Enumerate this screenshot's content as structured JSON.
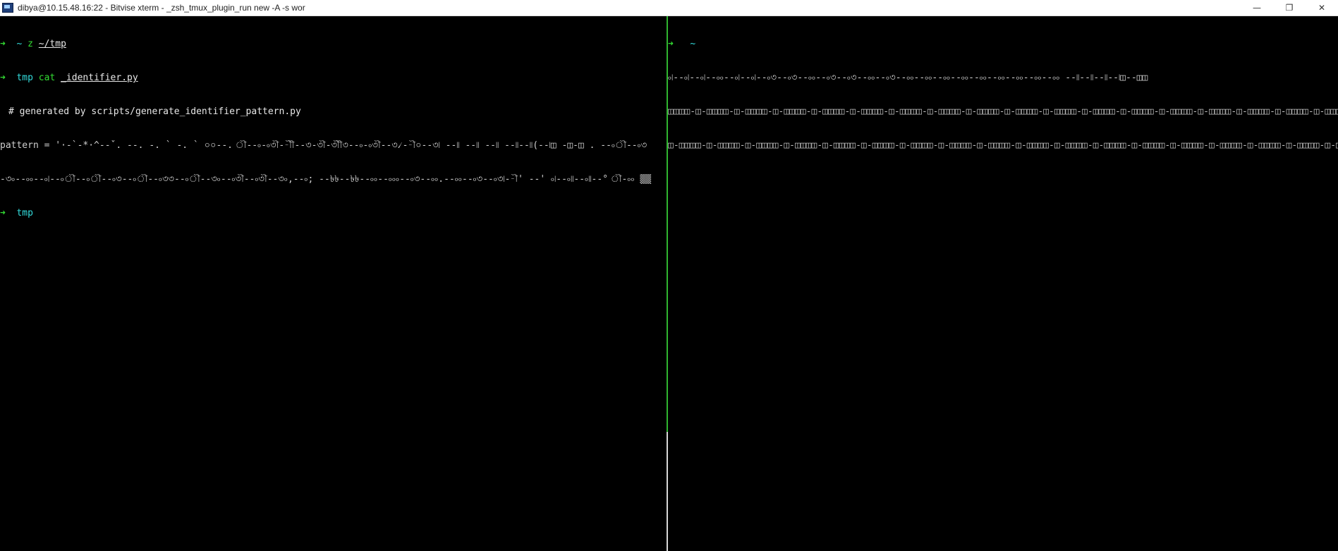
{
  "window": {
    "title": "dibya@10.15.48.16:22 - Bitvise xterm - _zsh_tmux_plugin_run new -A -s wor",
    "controls": [
      "—",
      "❐",
      "✕"
    ]
  },
  "left_pane": {
    "line1": {
      "arrow": "➜",
      "dir": "~",
      "cmd": "z",
      "arg": "~/tmp"
    },
    "line2": {
      "arrow": "➜",
      "dir": "tmp",
      "cmd": "cat",
      "arg": "_identifier.py"
    },
    "line3": "# generated by scripts/generate_identifier_pattern.py",
    "line4": "pattern = '·-`-*·^--ˇ. --. -. ` -. ` ০০--. ৗ--৹-৹৩ৗ--ৗৗ--৩-৩ৗ-৩ৗৗ৩--৹-৹৩ৗ--৩৴--ৗ০--৩৷ --৷৷ --৷৷ --৷৷ --৷৷--৷৷(--৷◫ -◫-◫ . --৹ৗ--৹৩",
    "line5": "-৩৹--৹৹--৹৷--৹ৗ--৹ৗ--৹৩--৹ৗ--৹৩৩--৹ৗ--৩৹--৹৩ৗ--৹৩ৗ--৩৹,--৹; --৳৳--৳৳--৹৹--৹৹৹--৹৩--৹৹.--৹৹--৹৩--৹৩৷--ৗ' --' ৹৷--৹৷৷--৹৷৷--° ৗ-৹৹ ▒▒",
    "line6": {
      "arrow": "➜",
      "dir": "tmp"
    }
  },
  "right_pane": {
    "line1": {
      "arrow": "➜",
      "dir": "~"
    },
    "line2": "৹৷--৹৷--৹৷--৹৹--৹৷--৹৷--৹৩--৹৩--৹৹--৹৩--৹৩--৹৹--৹৩--৹৹--৹৹--৹৹--৹৹--৹৹--৹৹--৹৹--৹৹--৹৹ --৷৷--৷৷--৷৷--৷◫--◫◫",
    "line3": "◫◫◫◫-◫-◫◫◫◫-◫-◫◫◫◫-◫-◫◫◫◫-◫-◫◫◫◫-◫-◫◫◫◫-◫-◫◫◫◫-◫-◫◫◫◫-◫-◫◫◫◫-◫-◫◫◫◫-◫-◫◫◫◫-◫-◫◫◫◫-◫-◫◫◫◫-◫-◫◫◫◫-◫-◫◫◫◫-◫-◫◫◫◫-◫-◫◫◫◫-◫-◫◫◫◫-◫--",
    "line4": "◫-◫◫◫◫-◫-◫◫◫◫-◫-◫◫◫◫-◫-◫◫◫◫-◫-◫◫◫◫-◫-◫◫◫◫-◫-◫◫◫◫-◫-◫◫◫◫-◫-◫◫◫◫-◫-◫◫◫◫-◫-◫◫◫◫-◫-◫◫◫◫-◫-◫◫◫◫-◫-◫◫◫◫-◫-◫◫◫◫-◫-◫◫◫◫-◫-◫◫◫◫-◫-◫◫◫◫---"
  },
  "colors": {
    "background": "#000000",
    "prompt_arrow": "#33dd33",
    "directory": "#33dddd",
    "pane_divider_active": "#2fb52f",
    "pane_divider_inactive": "#d8d8d8"
  }
}
